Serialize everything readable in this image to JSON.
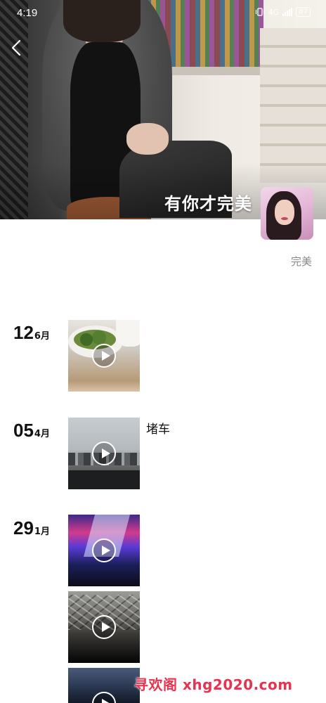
{
  "status_bar": {
    "time": "4:19",
    "network": "4G",
    "battery": "87"
  },
  "cover": {
    "title": "有你才完美"
  },
  "profile": {
    "name": "完美"
  },
  "entries": [
    {
      "day": "12",
      "month": "6月",
      "caption": ""
    },
    {
      "day": "05",
      "month": "4月",
      "caption": "堵车"
    },
    {
      "day": "29",
      "month": "1月",
      "caption": ""
    }
  ],
  "watermark": "寻欢阁 xhg2020.com",
  "colors": {
    "watermark": "#e8334f",
    "name_text": "#888888",
    "date_text": "#111111"
  }
}
